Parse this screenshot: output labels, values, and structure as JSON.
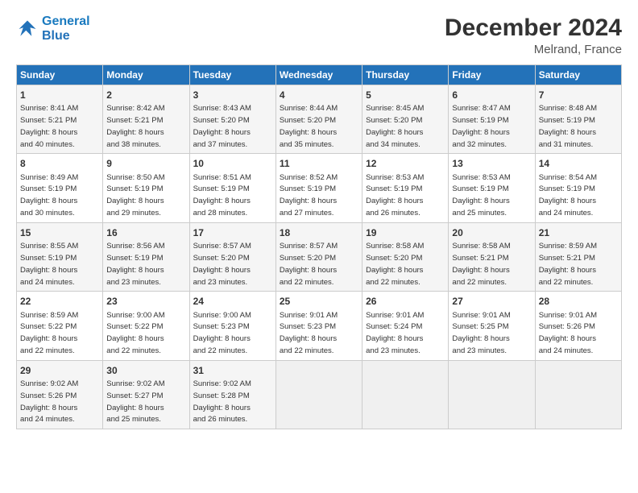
{
  "logo": {
    "line1": "General",
    "line2": "Blue"
  },
  "title": "December 2024",
  "subtitle": "Melrand, France",
  "days_header": [
    "Sunday",
    "Monday",
    "Tuesday",
    "Wednesday",
    "Thursday",
    "Friday",
    "Saturday"
  ],
  "weeks": [
    [
      {
        "day": "1",
        "info": "Sunrise: 8:41 AM\nSunset: 5:21 PM\nDaylight: 8 hours\nand 40 minutes."
      },
      {
        "day": "2",
        "info": "Sunrise: 8:42 AM\nSunset: 5:21 PM\nDaylight: 8 hours\nand 38 minutes."
      },
      {
        "day": "3",
        "info": "Sunrise: 8:43 AM\nSunset: 5:20 PM\nDaylight: 8 hours\nand 37 minutes."
      },
      {
        "day": "4",
        "info": "Sunrise: 8:44 AM\nSunset: 5:20 PM\nDaylight: 8 hours\nand 35 minutes."
      },
      {
        "day": "5",
        "info": "Sunrise: 8:45 AM\nSunset: 5:20 PM\nDaylight: 8 hours\nand 34 minutes."
      },
      {
        "day": "6",
        "info": "Sunrise: 8:47 AM\nSunset: 5:19 PM\nDaylight: 8 hours\nand 32 minutes."
      },
      {
        "day": "7",
        "info": "Sunrise: 8:48 AM\nSunset: 5:19 PM\nDaylight: 8 hours\nand 31 minutes."
      }
    ],
    [
      {
        "day": "8",
        "info": "Sunrise: 8:49 AM\nSunset: 5:19 PM\nDaylight: 8 hours\nand 30 minutes."
      },
      {
        "day": "9",
        "info": "Sunrise: 8:50 AM\nSunset: 5:19 PM\nDaylight: 8 hours\nand 29 minutes."
      },
      {
        "day": "10",
        "info": "Sunrise: 8:51 AM\nSunset: 5:19 PM\nDaylight: 8 hours\nand 28 minutes."
      },
      {
        "day": "11",
        "info": "Sunrise: 8:52 AM\nSunset: 5:19 PM\nDaylight: 8 hours\nand 27 minutes."
      },
      {
        "day": "12",
        "info": "Sunrise: 8:53 AM\nSunset: 5:19 PM\nDaylight: 8 hours\nand 26 minutes."
      },
      {
        "day": "13",
        "info": "Sunrise: 8:53 AM\nSunset: 5:19 PM\nDaylight: 8 hours\nand 25 minutes."
      },
      {
        "day": "14",
        "info": "Sunrise: 8:54 AM\nSunset: 5:19 PM\nDaylight: 8 hours\nand 24 minutes."
      }
    ],
    [
      {
        "day": "15",
        "info": "Sunrise: 8:55 AM\nSunset: 5:19 PM\nDaylight: 8 hours\nand 24 minutes."
      },
      {
        "day": "16",
        "info": "Sunrise: 8:56 AM\nSunset: 5:19 PM\nDaylight: 8 hours\nand 23 minutes."
      },
      {
        "day": "17",
        "info": "Sunrise: 8:57 AM\nSunset: 5:20 PM\nDaylight: 8 hours\nand 23 minutes."
      },
      {
        "day": "18",
        "info": "Sunrise: 8:57 AM\nSunset: 5:20 PM\nDaylight: 8 hours\nand 22 minutes."
      },
      {
        "day": "19",
        "info": "Sunrise: 8:58 AM\nSunset: 5:20 PM\nDaylight: 8 hours\nand 22 minutes."
      },
      {
        "day": "20",
        "info": "Sunrise: 8:58 AM\nSunset: 5:21 PM\nDaylight: 8 hours\nand 22 minutes."
      },
      {
        "day": "21",
        "info": "Sunrise: 8:59 AM\nSunset: 5:21 PM\nDaylight: 8 hours\nand 22 minutes."
      }
    ],
    [
      {
        "day": "22",
        "info": "Sunrise: 8:59 AM\nSunset: 5:22 PM\nDaylight: 8 hours\nand 22 minutes."
      },
      {
        "day": "23",
        "info": "Sunrise: 9:00 AM\nSunset: 5:22 PM\nDaylight: 8 hours\nand 22 minutes."
      },
      {
        "day": "24",
        "info": "Sunrise: 9:00 AM\nSunset: 5:23 PM\nDaylight: 8 hours\nand 22 minutes."
      },
      {
        "day": "25",
        "info": "Sunrise: 9:01 AM\nSunset: 5:23 PM\nDaylight: 8 hours\nand 22 minutes."
      },
      {
        "day": "26",
        "info": "Sunrise: 9:01 AM\nSunset: 5:24 PM\nDaylight: 8 hours\nand 23 minutes."
      },
      {
        "day": "27",
        "info": "Sunrise: 9:01 AM\nSunset: 5:25 PM\nDaylight: 8 hours\nand 23 minutes."
      },
      {
        "day": "28",
        "info": "Sunrise: 9:01 AM\nSunset: 5:26 PM\nDaylight: 8 hours\nand 24 minutes."
      }
    ],
    [
      {
        "day": "29",
        "info": "Sunrise: 9:02 AM\nSunset: 5:26 PM\nDaylight: 8 hours\nand 24 minutes."
      },
      {
        "day": "30",
        "info": "Sunrise: 9:02 AM\nSunset: 5:27 PM\nDaylight: 8 hours\nand 25 minutes."
      },
      {
        "day": "31",
        "info": "Sunrise: 9:02 AM\nSunset: 5:28 PM\nDaylight: 8 hours\nand 26 minutes."
      },
      {
        "day": "",
        "info": ""
      },
      {
        "day": "",
        "info": ""
      },
      {
        "day": "",
        "info": ""
      },
      {
        "day": "",
        "info": ""
      }
    ]
  ]
}
